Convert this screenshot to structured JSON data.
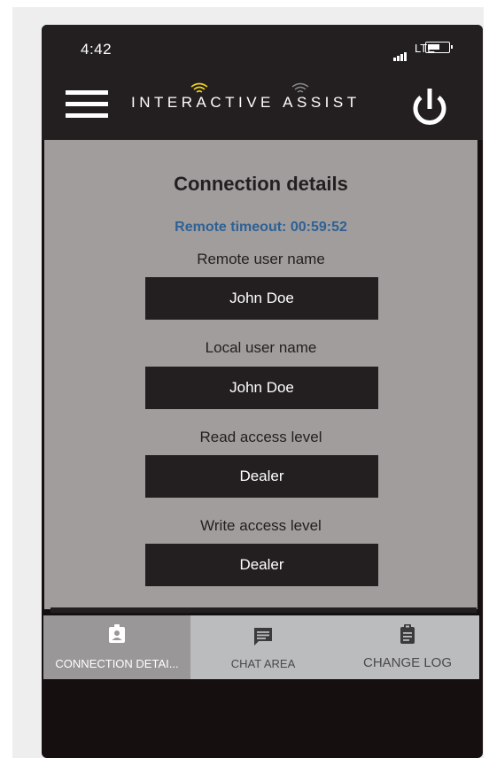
{
  "status_bar": {
    "time": "4:42",
    "network": "LTE"
  },
  "header": {
    "brand_left": "INTERACTIVE",
    "brand_right": "ASSIST",
    "menu_icon": "hamburger-menu-icon",
    "power_icon": "power-icon"
  },
  "main": {
    "title": "Connection details",
    "timeout_text": "Remote timeout: 00:59:52",
    "fields": [
      {
        "label": "Remote user name",
        "value": "John Doe"
      },
      {
        "label": "Local user name",
        "value": "John Doe"
      },
      {
        "label": "Read access level",
        "value": "Dealer"
      },
      {
        "label": "Write access level",
        "value": "Dealer"
      }
    ]
  },
  "tabs": [
    {
      "label": "CONNECTION DETAI...",
      "icon": "contact-card-icon",
      "active": true
    },
    {
      "label": "CHAT AREA",
      "icon": "chat-bubble-icon",
      "active": false
    },
    {
      "label": "CHANGE LOG",
      "icon": "clipboard-icon",
      "active": false
    }
  ],
  "colors": {
    "bar_dark": "#231f20",
    "content_gray": "#a19d9d",
    "timeout_blue": "#2e6194",
    "wifi_yellow": "#f2d21d",
    "tab_bar": "#bbbcbe",
    "tab_active": "#999798"
  }
}
